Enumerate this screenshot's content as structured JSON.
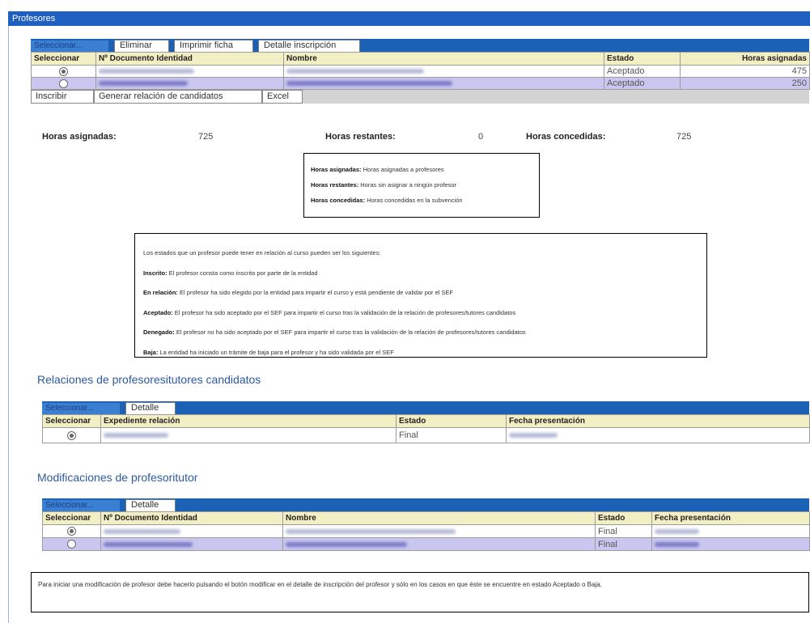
{
  "window": {
    "title": "Profesores"
  },
  "teachers": {
    "tabs": {
      "selected": "Seleccionar...",
      "delete": "Eliminar",
      "print": "Imprimir ficha",
      "detail": "Detalle inscripción"
    },
    "columns": [
      "Seleccionar",
      "Nº Documento Identidad",
      "Nombre",
      "Estado",
      "Horas asignadas"
    ],
    "rows": [
      {
        "selected": true,
        "estado": "Aceptado",
        "horas": "475"
      },
      {
        "selected": false,
        "estado": "Aceptado",
        "horas": "250"
      }
    ],
    "buttons": {
      "enroll": "Inscribir",
      "generate": "Generar relación de candidatos",
      "excel": "Excel"
    }
  },
  "hours": {
    "assigned_label": "Horas asignadas:",
    "assigned_value": "725",
    "remaining_label": "Horas restantes:",
    "remaining_value": "0",
    "granted_label": "Horas concedidas:",
    "granted_value": "725"
  },
  "hours_legend": [
    {
      "term": "Horas asignadas:",
      "desc": " Horas asignadas a profesores"
    },
    {
      "term": "Horas restantes:",
      "desc": " Horas sin asignar a ningún profesor"
    },
    {
      "term": "Horas concedidas:",
      "desc": " Horas concedidas en la subvención"
    }
  ],
  "states_legend": {
    "intro": "Los estados que un profesor puede tener en relación al curso pueden ser los siguientes:",
    "items": [
      {
        "term": "Inscrito:",
        "desc": " El profesor consta como inscrito por parte de la entidad"
      },
      {
        "term": "En relación:",
        "desc": " El profesor ha sido elegido por la entidad para impartir el curso y está pendiente de validar por el SEF"
      },
      {
        "term": "Aceptado:",
        "desc": " El profesor ha sido aceptado por el SEF para impartir el curso tras la validación de la relación de profesores/tutores candidatos"
      },
      {
        "term": "Denegado:",
        "desc": " El profesor no ha sido aceptado por el SEF para impartir el curso tras la validación de la relación de profesores/tutores candidatos"
      },
      {
        "term": "Baja:",
        "desc": " La entidad ha iniciado un trámite de baja para el profesor y ha sido validada por el SEF"
      }
    ]
  },
  "relations": {
    "title": "Relaciones de profesoresitutores candidatos",
    "tabs": {
      "selected": "Seleccionar...",
      "detail": "Detalle"
    },
    "columns": [
      "Seleccionar",
      "Expediente relación",
      "Estado",
      "Fecha presentación"
    ],
    "rows": [
      {
        "selected": true,
        "estado": "Final"
      }
    ]
  },
  "modifications": {
    "title": "Modificaciones de profesoritutor",
    "tabs": {
      "selected": "Seleccionar...",
      "detail": "Detalle"
    },
    "columns": [
      "Seleccionar",
      "Nº Documento Identidad",
      "Nombre",
      "Estado",
      "Fecha presentación"
    ],
    "rows": [
      {
        "selected": true,
        "estado": "Final"
      },
      {
        "selected": false,
        "estado": "Final"
      }
    ]
  },
  "note": "Para iniciar una modificación de profesor debe hacerlo pulsando el botón modificar en el detalle de inscripción del profesor y sólo en los casos en que éste se encuentre en estado Aceptado o Baja."
}
